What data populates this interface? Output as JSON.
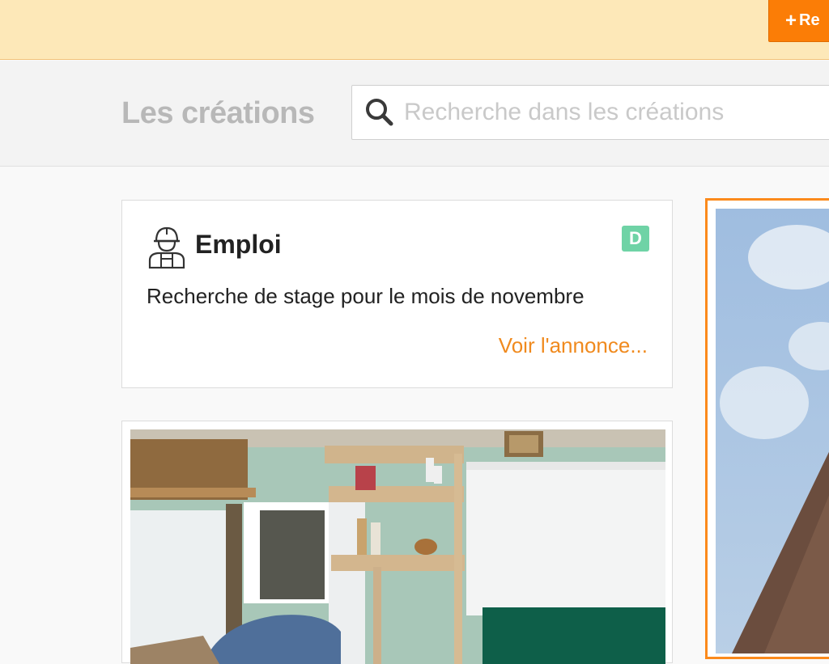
{
  "top_banner": {
    "add_button_label": "Re"
  },
  "header": {
    "title": "Les créations",
    "search": {
      "placeholder": "Recherche dans les créations",
      "value": ""
    }
  },
  "job_card": {
    "category": "Emploi",
    "badge": "D",
    "description": "Recherche de stage pour le mois de novembre",
    "link_label": "Voir l'annonce..."
  },
  "colors": {
    "accent": "#fb7d06",
    "link": "#f08a1e",
    "badge": "#6fd3a6",
    "banner": "#fde8b8"
  },
  "icons": {
    "add": "plus-icon",
    "search": "search-icon",
    "category": "construction-worker-icon"
  }
}
